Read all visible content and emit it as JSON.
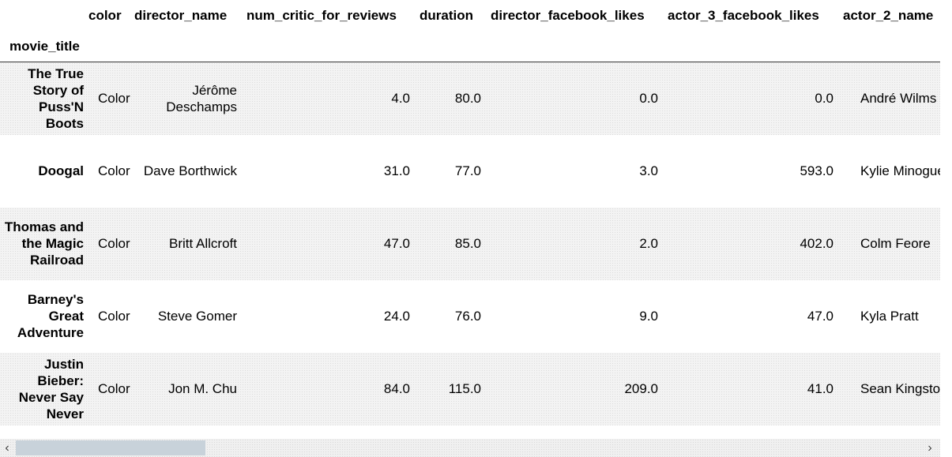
{
  "table": {
    "index_name": "movie_title",
    "columns": [
      "color",
      "director_name",
      "num_critic_for_reviews",
      "duration",
      "director_facebook_likes",
      "actor_3_facebook_likes",
      "actor_2_name"
    ],
    "rows": [
      {
        "index": "The True Story of Puss'N Boots",
        "cells": [
          "Color",
          "Jérôme Deschamps",
          "4.0",
          "80.0",
          "0.0",
          "0.0",
          "André Wilms"
        ]
      },
      {
        "index": "Doogal",
        "cells": [
          "Color",
          "Dave Borthwick",
          "31.0",
          "77.0",
          "3.0",
          "593.0",
          "Kylie Minogue"
        ]
      },
      {
        "index": "Thomas and the Magic Railroad",
        "cells": [
          "Color",
          "Britt Allcroft",
          "47.0",
          "85.0",
          "2.0",
          "402.0",
          "Colm Feore"
        ]
      },
      {
        "index": "Barney's Great Adventure",
        "cells": [
          "Color",
          "Steve Gomer",
          "24.0",
          "76.0",
          "9.0",
          "47.0",
          "Kyla Pratt"
        ]
      },
      {
        "index": "Justin Bieber: Never Say Never",
        "cells": [
          "Color",
          "Jon M. Chu",
          "84.0",
          "115.0",
          "209.0",
          "41.0",
          "Sean Kingston"
        ]
      }
    ]
  },
  "scrollbar": {
    "left_arrow": "‹",
    "right_arrow": "›"
  }
}
